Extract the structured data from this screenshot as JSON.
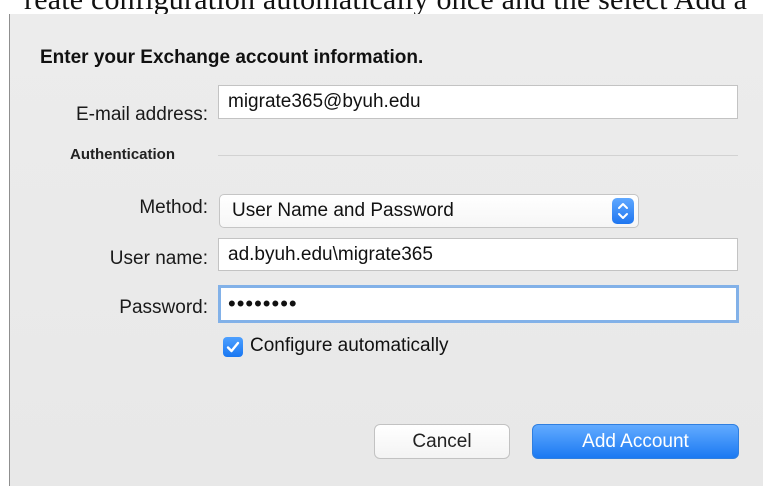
{
  "top_fragment": {
    "text": "reate configuration automatically once and the select Add a"
  },
  "dialog": {
    "heading": "Enter your Exchange account information.",
    "email": {
      "label": "E-mail address:",
      "value": "migrate365@byuh.edu"
    },
    "authentication": {
      "section_label": "Authentication",
      "method": {
        "label": "Method:",
        "selected": "User Name and Password",
        "icon": "chevron-updown-icon"
      },
      "username": {
        "label": "User name:",
        "value": "ad.byuh.edu\\migrate365"
      },
      "password": {
        "label": "Password:",
        "masked_value": "••••••••"
      }
    },
    "configure_automatically": {
      "label": "Configure automatically",
      "checked": true,
      "icon": "checkmark-icon"
    },
    "buttons": {
      "cancel": "Cancel",
      "add_account": "Add Account"
    }
  },
  "colors": {
    "dialog_background": "#ececec",
    "accent_blue": "#1f76f0",
    "focus_ring": "#82b1e8"
  }
}
